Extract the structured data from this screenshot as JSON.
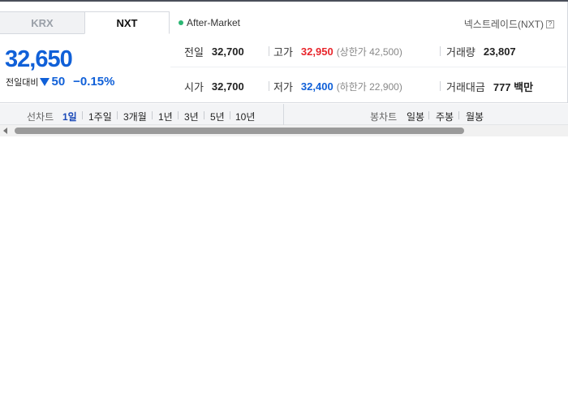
{
  "tabs": [
    {
      "label": "KRX",
      "active": false
    },
    {
      "label": "NXT",
      "active": true
    }
  ],
  "session": {
    "status": "After-Market",
    "exchange": "넥스트레이드(NXT)",
    "help_icon": "?"
  },
  "price": {
    "current": "32,650",
    "change_label": "전일대비",
    "change_icon": "down-triangle-icon",
    "change_value": "50",
    "change_percent": "−0.15%",
    "color": "#1060d8"
  },
  "stats": {
    "prev_close": {
      "label": "전일",
      "value": "32,700"
    },
    "high": {
      "label": "고가",
      "value": "32,950",
      "upper_limit": "(상한가 42,500)"
    },
    "volume": {
      "label": "거래량",
      "value": "23,807"
    },
    "open": {
      "label": "시가",
      "value": "32,700"
    },
    "low": {
      "label": "저가",
      "value": "32,400",
      "lower_limit": "(하한가 22,900)"
    },
    "amount": {
      "label": "거래대금",
      "value": "777 백만"
    }
  },
  "period_bar": {
    "line_label": "선차트",
    "line_items": [
      "1일",
      "1주일",
      "3개월",
      "1년",
      "3년",
      "5년",
      "10년"
    ],
    "active_line_item": "1일",
    "candle_label": "봉차트",
    "candle_items": [
      "일봉",
      "주봉",
      "월봉"
    ]
  },
  "colors": {
    "up": "#e8262c",
    "down": "#1060d8",
    "accent": "#1a49b8"
  }
}
